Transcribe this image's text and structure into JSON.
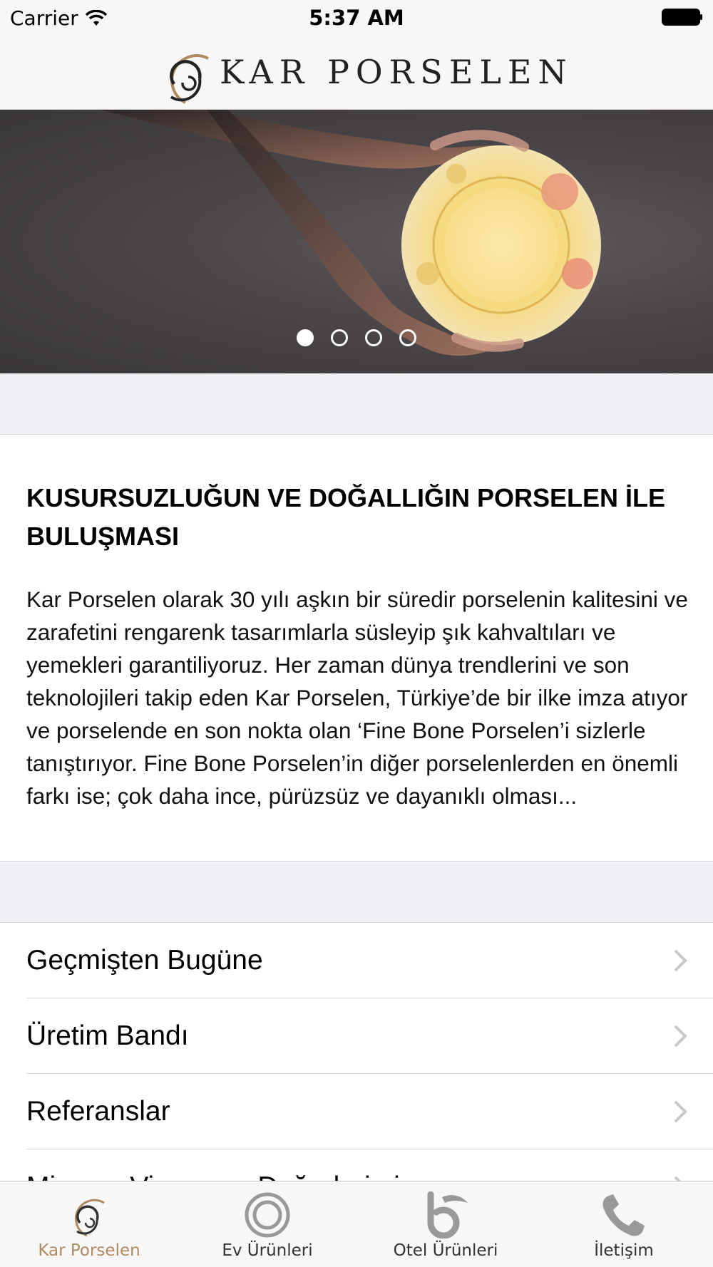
{
  "status_bar": {
    "carrier": "Carrier",
    "time": "5:37 AM"
  },
  "header": {
    "brand": "KAR PORSELEN",
    "accent_color": "#b08a60"
  },
  "carousel": {
    "page_count": 4,
    "current_page": 1
  },
  "intro": {
    "title": "KUSURSUZLUĞUN VE DOĞALLIĞIN PORSELEN İLE BULUŞMASI",
    "body": "Kar Porselen olarak 30 yılı aşkın bir süredir porselenin kalitesini ve zarafetini rengarenk tasarımlarla süsleyip şık kahvaltıları ve yemekleri garantiliyoruz. Her zaman dünya trendlerini ve son teknolojileri takip eden Kar Porselen, Türkiye’de bir ilke imza atıyor ve porselende en son nokta olan ‘Fine Bone Porselen’i sizlerle tanıştırıyor. Fine Bone Porselen’in diğer porselenlerden en önemli farkı ise; çok daha ince, pürüzsüz ve dayanıklı olması..."
  },
  "menu": {
    "items": [
      {
        "label": "Geçmişten Bugüne"
      },
      {
        "label": "Üretim Bandı"
      },
      {
        "label": "Referanslar"
      },
      {
        "label": "Misyon, Vizyon ve Değerlerimiz"
      }
    ]
  },
  "tab_bar": {
    "active_color": "#b08a60",
    "tabs": [
      {
        "label": "Kar Porselen",
        "icon": "kar-porselen-logo-icon",
        "active": true
      },
      {
        "label": "Ev Ürünleri",
        "icon": "ring-icon",
        "active": false
      },
      {
        "label": "Otel Ürünleri",
        "icon": "b-logo-icon",
        "active": false
      },
      {
        "label": "İletişim",
        "icon": "phone-icon",
        "active": false
      }
    ]
  }
}
